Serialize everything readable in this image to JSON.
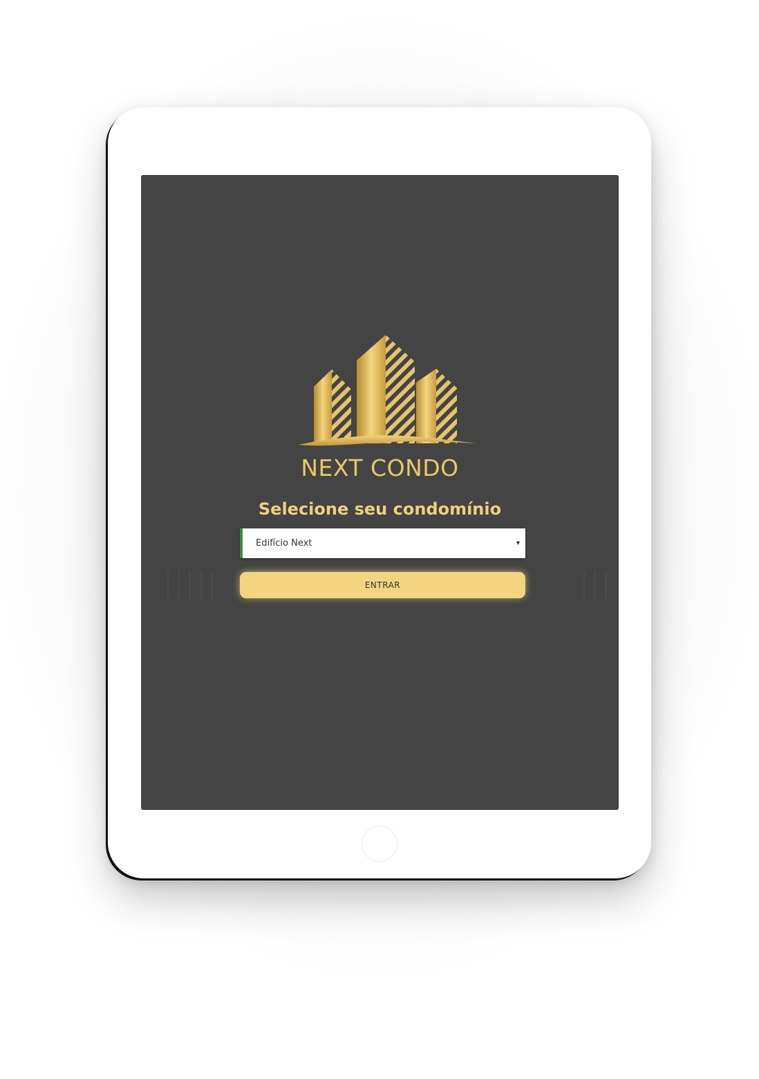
{
  "app": {
    "brand_name": "NEXT CONDO",
    "logo_icon": "buildings-logo-icon"
  },
  "login": {
    "prompt": "Selecione seu condomínio",
    "condo_select": {
      "value": "Edifício Next",
      "caret": "▾"
    },
    "enter_label": "ENTRAR"
  },
  "colors": {
    "screen_background": "#444444",
    "gold": "#e8c86a",
    "button_gold": "#f2d481",
    "select_accent": "#3a8f3a",
    "device_frame": "#ffffff"
  }
}
